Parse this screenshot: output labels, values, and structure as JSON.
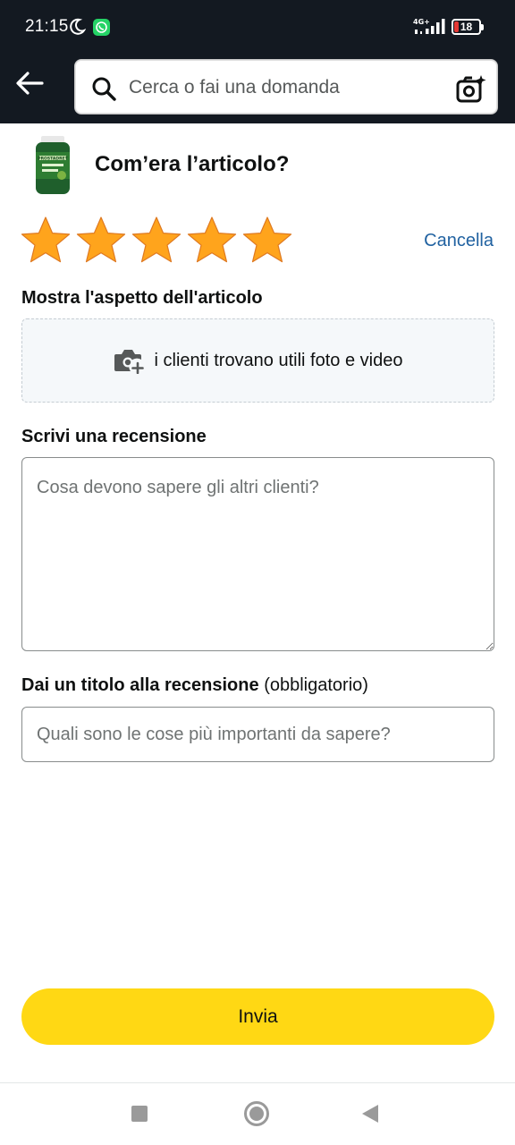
{
  "status_bar": {
    "time": "21:15",
    "network": "4G+",
    "battery": "18",
    "battery_level": 0.18
  },
  "header": {
    "search_placeholder": "Cerca o fai una domanda"
  },
  "product": {
    "question": "Com’era l’articolo?",
    "thumbnail_label": "PROSTADRET"
  },
  "rating": {
    "stars_selected": 5,
    "stars_total": 5,
    "clear_label": "Cancella",
    "star_color": "#ffa41c"
  },
  "media": {
    "section_label": "Mostra l'aspetto dell'articolo",
    "upload_text": "i clienti trovano utili foto e video"
  },
  "review": {
    "section_label": "Scrivi una recensione",
    "placeholder": "Cosa devono sapere gli altri clienti?"
  },
  "title": {
    "section_label": "Dai un titolo alla recensione",
    "optional_label": "(obbligatorio)",
    "placeholder": "Quali sono le cose più importanti da sapere?"
  },
  "submit": {
    "label": "Invia",
    "color": "#ffd814"
  },
  "colors": {
    "header_bg": "#131921",
    "link": "#2162a1"
  }
}
